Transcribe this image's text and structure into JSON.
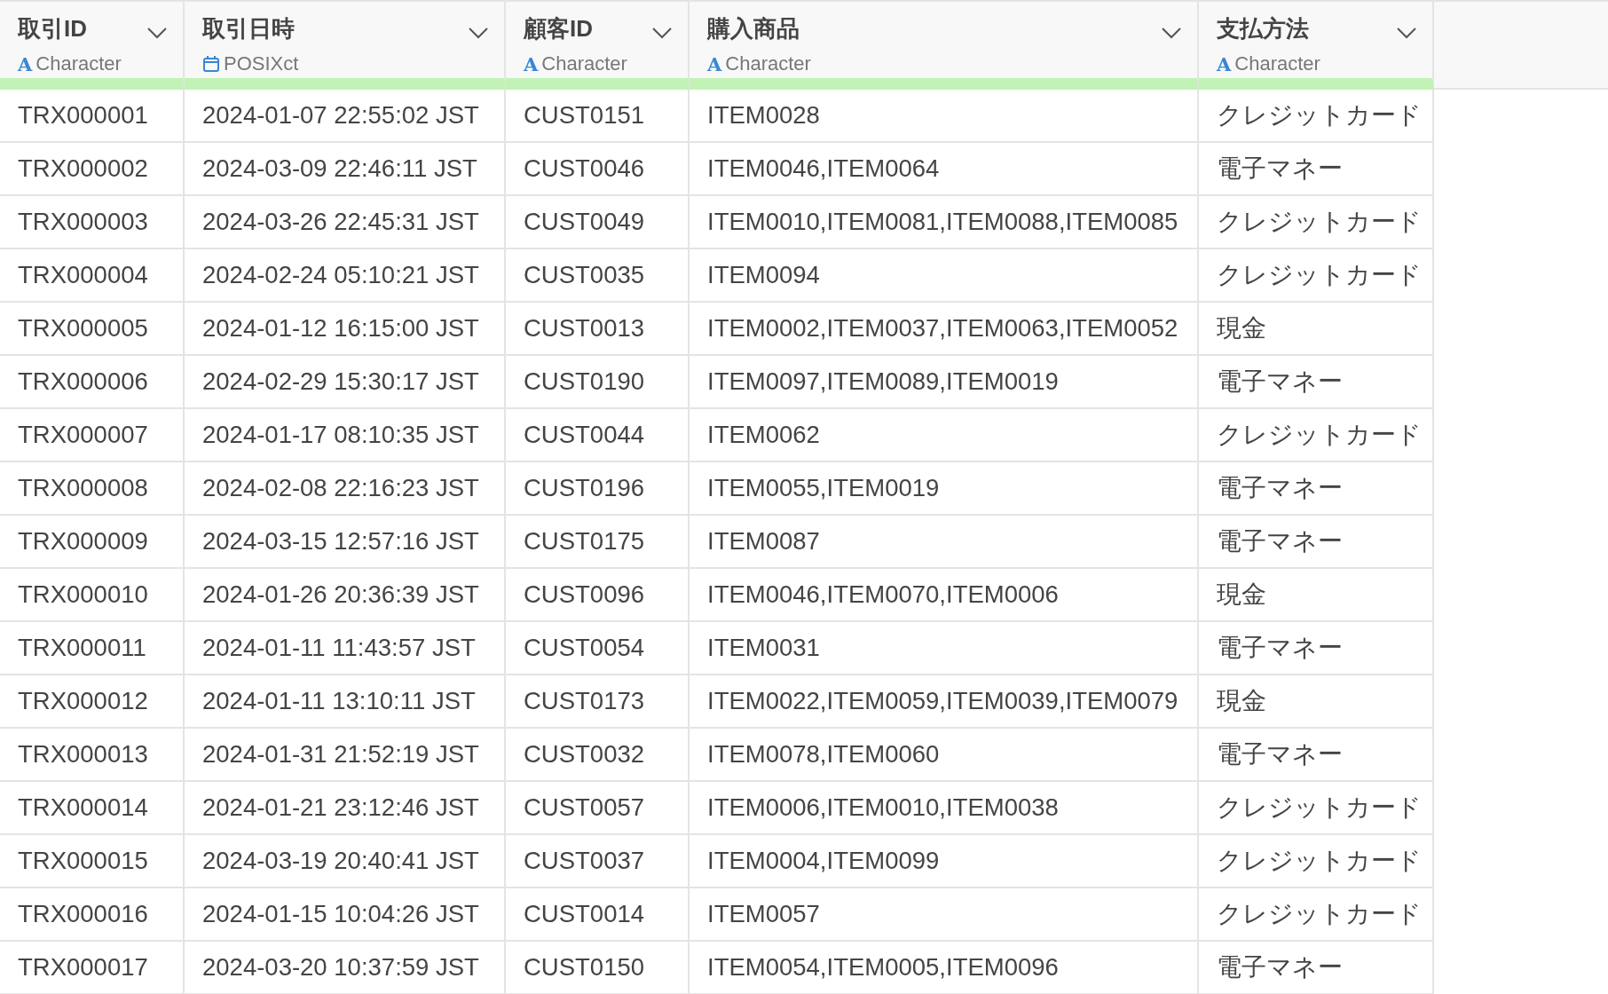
{
  "table": {
    "columns": [
      {
        "title": "取引ID",
        "kind": "character",
        "type_icon": "A",
        "type_label": "Character"
      },
      {
        "title": "取引日時",
        "kind": "datetime",
        "type_label": "POSIXct"
      },
      {
        "title": "顧客ID",
        "kind": "character",
        "type_icon": "A",
        "type_label": "Character"
      },
      {
        "title": "購入商品",
        "kind": "character",
        "type_icon": "A",
        "type_label": "Character"
      },
      {
        "title": "支払方法",
        "kind": "character",
        "type_icon": "A",
        "type_label": "Character"
      }
    ],
    "rows": [
      [
        "TRX000001",
        "2024-01-07 22:55:02 JST",
        "CUST0151",
        "ITEM0028",
        "クレジットカード"
      ],
      [
        "TRX000002",
        "2024-03-09 22:46:11 JST",
        "CUST0046",
        "ITEM0046,ITEM0064",
        "電子マネー"
      ],
      [
        "TRX000003",
        "2024-03-26 22:45:31 JST",
        "CUST0049",
        "ITEM0010,ITEM0081,ITEM0088,ITEM0085",
        "クレジットカード"
      ],
      [
        "TRX000004",
        "2024-02-24 05:10:21 JST",
        "CUST0035",
        "ITEM0094",
        "クレジットカード"
      ],
      [
        "TRX000005",
        "2024-01-12 16:15:00 JST",
        "CUST0013",
        "ITEM0002,ITEM0037,ITEM0063,ITEM0052",
        "現金"
      ],
      [
        "TRX000006",
        "2024-02-29 15:30:17 JST",
        "CUST0190",
        "ITEM0097,ITEM0089,ITEM0019",
        "電子マネー"
      ],
      [
        "TRX000007",
        "2024-01-17 08:10:35 JST",
        "CUST0044",
        "ITEM0062",
        "クレジットカード"
      ],
      [
        "TRX000008",
        "2024-02-08 22:16:23 JST",
        "CUST0196",
        "ITEM0055,ITEM0019",
        "電子マネー"
      ],
      [
        "TRX000009",
        "2024-03-15 12:57:16 JST",
        "CUST0175",
        "ITEM0087",
        "電子マネー"
      ],
      [
        "TRX000010",
        "2024-01-26 20:36:39 JST",
        "CUST0096",
        "ITEM0046,ITEM0070,ITEM0006",
        "現金"
      ],
      [
        "TRX000011",
        "2024-01-11 11:43:57 JST",
        "CUST0054",
        "ITEM0031",
        "電子マネー"
      ],
      [
        "TRX000012",
        "2024-01-11 13:10:11 JST",
        "CUST0173",
        "ITEM0022,ITEM0059,ITEM0039,ITEM0079",
        "現金"
      ],
      [
        "TRX000013",
        "2024-01-31 21:52:19 JST",
        "CUST0032",
        "ITEM0078,ITEM0060",
        "電子マネー"
      ],
      [
        "TRX000014",
        "2024-01-21 23:12:46 JST",
        "CUST0057",
        "ITEM0006,ITEM0010,ITEM0038",
        "クレジットカード"
      ],
      [
        "TRX000015",
        "2024-03-19 20:40:41 JST",
        "CUST0037",
        "ITEM0004,ITEM0099",
        "クレジットカード"
      ],
      [
        "TRX000016",
        "2024-01-15 10:04:26 JST",
        "CUST0014",
        "ITEM0057",
        "クレジットカード"
      ],
      [
        "TRX000017",
        "2024-03-20 10:37:59 JST",
        "CUST0150",
        "ITEM0054,ITEM0005,ITEM0096",
        "電子マネー"
      ]
    ]
  }
}
